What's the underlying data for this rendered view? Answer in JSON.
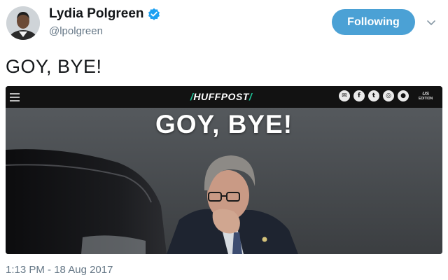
{
  "author": {
    "name": "Lydia Polgreen",
    "handle": "@lpolgreen",
    "verified": true
  },
  "follow_button": {
    "label": "Following"
  },
  "tweet": {
    "text": "GOY, BYE!",
    "timestamp": "1:13 PM - 18 Aug 2017"
  },
  "media": {
    "site_header": {
      "logo_text": "HUFFPOST",
      "edition_label": "US",
      "edition_sublabel": "EDITION",
      "social_icons": [
        "mail-icon",
        "facebook-icon",
        "twitter-icon",
        "instagram-icon",
        "notification-icon"
      ]
    },
    "headline": "GOY, BYE!"
  },
  "colors": {
    "follow_button": "#4ba1d5",
    "verified_badge": "#1da1f2",
    "handle_text": "#657786",
    "huffpost_accent": "#1fc79a",
    "site_bar": "#121212"
  }
}
